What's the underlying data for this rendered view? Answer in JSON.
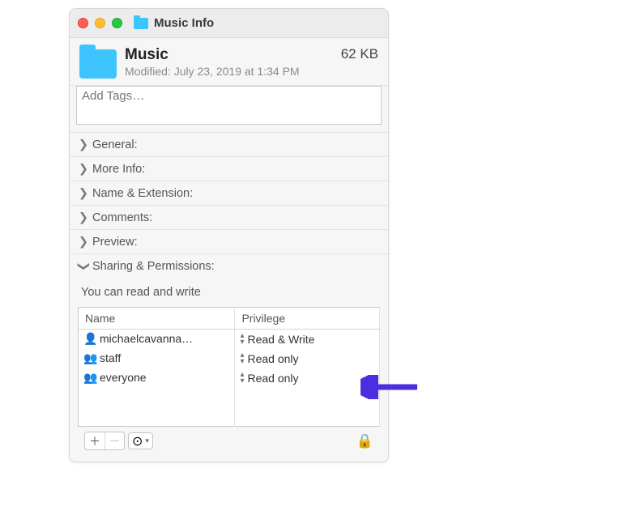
{
  "window": {
    "title": "Music Info"
  },
  "header": {
    "name": "Music",
    "size": "62 KB",
    "modified": "Modified:  July 23, 2019 at 1:34 PM"
  },
  "tags": {
    "placeholder": "Add Tags…"
  },
  "sections": {
    "general": "General:",
    "moreinfo": "More Info:",
    "nameext": "Name & Extension:",
    "comments": "Comments:",
    "preview": "Preview:",
    "sharing": "Sharing & Permissions:"
  },
  "sharing": {
    "summary": "You can read and write",
    "columns": {
      "name": "Name",
      "privilege": "Privilege"
    },
    "rows": [
      {
        "user": "michaelcavanna…",
        "priv": "Read & Write",
        "icon": "person"
      },
      {
        "user": "staff",
        "priv": "Read only",
        "icon": "people2"
      },
      {
        "user": "everyone",
        "priv": "Read only",
        "icon": "people3"
      }
    ]
  },
  "icons": {
    "person": "👤",
    "people2": "👥",
    "people3": "👥",
    "lock": "🔒",
    "gear": "⊙"
  }
}
